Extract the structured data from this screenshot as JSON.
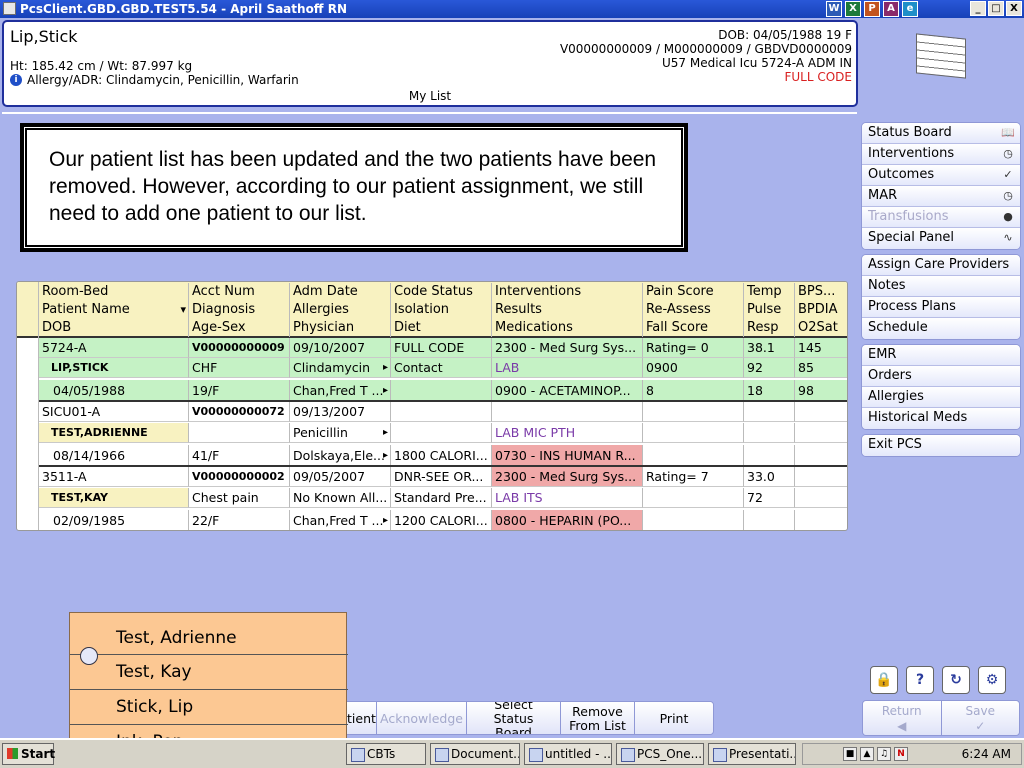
{
  "window": {
    "title": "PcsClient.GBD.GBD.TEST5.54 - April Saathoff RN",
    "apps": [
      "W",
      "X",
      "P",
      "A",
      "e"
    ],
    "controls": [
      "_",
      "□",
      "X"
    ]
  },
  "patient": {
    "name": "Lip,Stick",
    "ht_wt": "Ht: 185.42 cm / Wt: 87.997 kg",
    "allergy": "Allergy/ADR: Clindamycin, Penicillin, Warfarin",
    "dob_line": "DOB: 04/05/1988 19 F",
    "ids": "V00000000009 / M000000009 / GBDVD0000009",
    "location": "U57 Medical Icu  5724-A  ADM IN",
    "code": "FULL CODE",
    "list_label": "My List"
  },
  "callout": {
    "text": "Our patient list has been updated and the two patients have been removed. However, according to our patient assignment, we still need to add one patient to our list."
  },
  "table": {
    "headers": [
      [
        "Room-Bed",
        "Patient Name",
        "DOB"
      ],
      [
        "Acct Num",
        "Diagnosis",
        "Age-Sex"
      ],
      [
        "Adm Date",
        "Allergies",
        "Physician"
      ],
      [
        "Code Status",
        "Isolation",
        "Diet"
      ],
      [
        "Interventions",
        "Results",
        "Medications"
      ],
      [
        "Pain Score",
        "Re-Assess",
        "Fall Score"
      ],
      [
        "Temp",
        "Pulse",
        "Resp"
      ],
      [
        "BPS...",
        "BPDIA",
        "O2Sat"
      ]
    ],
    "patients": [
      {
        "r1": [
          "5724-A",
          "V00000000009",
          "09/10/2007",
          "FULL CODE",
          "2300 - Med Surg Sys...",
          "Rating= 0",
          "38.1",
          "145"
        ],
        "r2": [
          "LIP,STICK",
          "CHF",
          "Clindamycin",
          "Contact",
          "LAB",
          "0900",
          "92",
          "85"
        ],
        "r3": [
          "04/05/1988",
          "19/F",
          "Chan,Fred T ...",
          "",
          "0900 - ACETAMINOP...",
          "8",
          "18",
          "98"
        ]
      },
      {
        "r1": [
          "SICU01-A",
          "V00000000072",
          "09/13/2007",
          "",
          "",
          "",
          "",
          ""
        ],
        "r2": [
          "TEST,ADRIENNE",
          "",
          "Penicillin",
          "",
          "LAB MIC PTH",
          "",
          "",
          ""
        ],
        "r3": [
          "08/14/1966",
          "41/F",
          "Dolskaya,Ele...",
          "1800 CALORI...",
          "0730 - INS HUMAN R...",
          "",
          "",
          ""
        ]
      },
      {
        "r1": [
          "3511-A",
          "V00000000002",
          "09/05/2007",
          "DNR-SEE OR...",
          "2300 - Med Surg Sys...",
          "Rating= 7",
          "33.0",
          ""
        ],
        "r2": [
          "TEST,KAY",
          "Chest pain",
          "No Known All...",
          "Standard Pre...",
          "LAB ITS",
          "",
          "72",
          ""
        ],
        "r3": [
          "02/09/1985",
          "22/F",
          "Chan,Fred T ...",
          "1200 CALORI...",
          "0800 - HEPARIN (PO...",
          "",
          "",
          ""
        ]
      }
    ]
  },
  "right_panel": {
    "group1": [
      "Status Board",
      "Interventions",
      "Outcomes",
      "MAR",
      "Transfusions",
      "Special Panel"
    ],
    "group2": [
      "Assign Care Providers",
      "Notes",
      "Process Plans",
      "Schedule"
    ],
    "group3": [
      "EMR",
      "Orders",
      "Allergies",
      "Historical Meds"
    ],
    "group4": [
      "Exit PCS"
    ],
    "return_label": "Return",
    "save_label": "Save"
  },
  "bottom_toolbar": {
    "patient": "tient",
    "acknowledge": "Acknowledge",
    "select_sb_1": "Select",
    "select_sb_2": "Status Board",
    "remove_1": "Remove",
    "remove_2": "From List",
    "print": "Print"
  },
  "overlay": {
    "items": [
      "Test, Adrienne",
      "Test, Kay",
      "Stick, Lip",
      "Ink, Pen"
    ]
  },
  "taskbar": {
    "start": "Start",
    "tasks": [
      "CBTs",
      "Document...",
      "untitled - ...",
      "PCS_One...",
      "Presentati..."
    ],
    "clock": "6:24 AM"
  }
}
